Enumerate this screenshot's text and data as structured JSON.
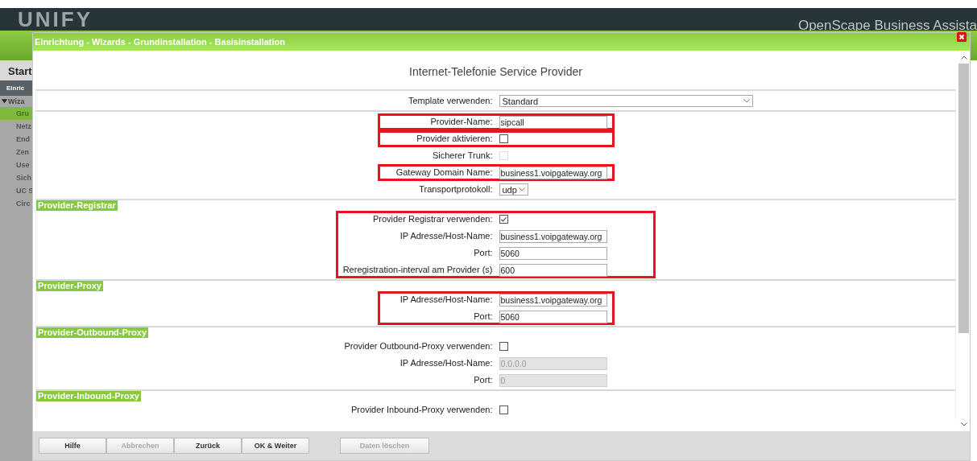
{
  "app": {
    "logo": "UNIFY",
    "product": "OpenScape Business Assista"
  },
  "sidebar": {
    "title": "Start",
    "section": "Einric",
    "group": {
      "label": "Wiza",
      "expanded": true
    },
    "items": [
      {
        "label": "Gru",
        "selected": true
      },
      {
        "label": "Netz",
        "selected": false
      },
      {
        "label": "End",
        "selected": false
      },
      {
        "label": "Zen",
        "selected": false
      },
      {
        "label": "Use",
        "selected": false
      },
      {
        "label": "Sich",
        "selected": false
      },
      {
        "label": "UC S",
        "selected": false
      },
      {
        "label": "Circ",
        "selected": false
      }
    ]
  },
  "dialog": {
    "title": "Einrichtung - Wizards - Grundinstallation - Basisinstallation",
    "heading": "Internet-Telefonie Service Provider",
    "sections": [
      {
        "groups": [
          {
            "highlighted": false,
            "rows": [
              {
                "kind": "select",
                "label": "Template verwenden:",
                "value": "Standard"
              }
            ]
          }
        ]
      },
      {
        "groups": [
          {
            "highlighted": true,
            "rows": [
              {
                "kind": "text",
                "label": "Provider-Name:",
                "value": "sipcall",
                "disabled": false
              }
            ]
          },
          {
            "highlighted": true,
            "rows": [
              {
                "kind": "checkbox",
                "label": "Provider aktivieren:",
                "checked": false,
                "disabled": false
              }
            ]
          },
          {
            "highlighted": false,
            "rows": [
              {
                "kind": "checkbox",
                "label": "Sicherer Trunk:",
                "checked": false,
                "disabled": true
              }
            ]
          },
          {
            "highlighted": true,
            "rows": [
              {
                "kind": "text",
                "label": "Gateway Domain Name:",
                "value": "business1.voipgateway.org",
                "disabled": false
              }
            ]
          },
          {
            "highlighted": false,
            "rows": [
              {
                "kind": "miniselect",
                "label": "Transportprotokoll:",
                "value": "udp"
              }
            ]
          }
        ]
      },
      {
        "legend": "Provider-Registrar",
        "groups": [
          {
            "highlighted": true,
            "rows": [
              {
                "kind": "checkbox",
                "label": "Provider Registrar verwenden:",
                "checked": true,
                "disabled": false
              },
              {
                "kind": "text",
                "label": "IP Adresse/Host-Name:",
                "value": "business1.voipgateway.org",
                "disabled": false
              },
              {
                "kind": "text",
                "label": "Port:",
                "value": "5060",
                "disabled": false
              },
              {
                "kind": "text",
                "label": "Reregistration-interval am Provider (s)",
                "value": "600",
                "disabled": false
              }
            ]
          }
        ]
      },
      {
        "legend": "Provider-Proxy",
        "groups": [
          {
            "highlighted": true,
            "rows": [
              {
                "kind": "text",
                "label": "IP Adresse/Host-Name:",
                "value": "business1.voipgateway.org",
                "disabled": false
              },
              {
                "kind": "text",
                "label": "Port:",
                "value": "5060",
                "disabled": false
              }
            ]
          }
        ]
      },
      {
        "legend": "Provider-Outbound-Proxy",
        "groups": [
          {
            "highlighted": false,
            "rows": [
              {
                "kind": "checkbox",
                "label": "Provider Outbound-Proxy verwenden:",
                "checked": false,
                "disabled": false
              },
              {
                "kind": "text",
                "label": "IP Adresse/Host-Name:",
                "value": "0.0.0.0",
                "disabled": true
              },
              {
                "kind": "text",
                "label": "Port:",
                "value": "0",
                "disabled": true
              }
            ]
          }
        ]
      },
      {
        "legend": "Provider-Inbound-Proxy",
        "groups": [
          {
            "highlighted": false,
            "rows": [
              {
                "kind": "checkbox",
                "label": "Provider Inbound-Proxy verwenden:",
                "checked": false,
                "disabled": false
              }
            ]
          }
        ]
      }
    ],
    "buttons": [
      {
        "label": "Hilfe",
        "disabled": false
      },
      {
        "label": "Abbrechen",
        "disabled": true
      },
      {
        "label": "Zurück",
        "disabled": false
      },
      {
        "label": "OK & Weiter",
        "disabled": false
      }
    ],
    "extra_buttons": [
      {
        "label": "Daten löschen",
        "disabled": true
      }
    ]
  }
}
